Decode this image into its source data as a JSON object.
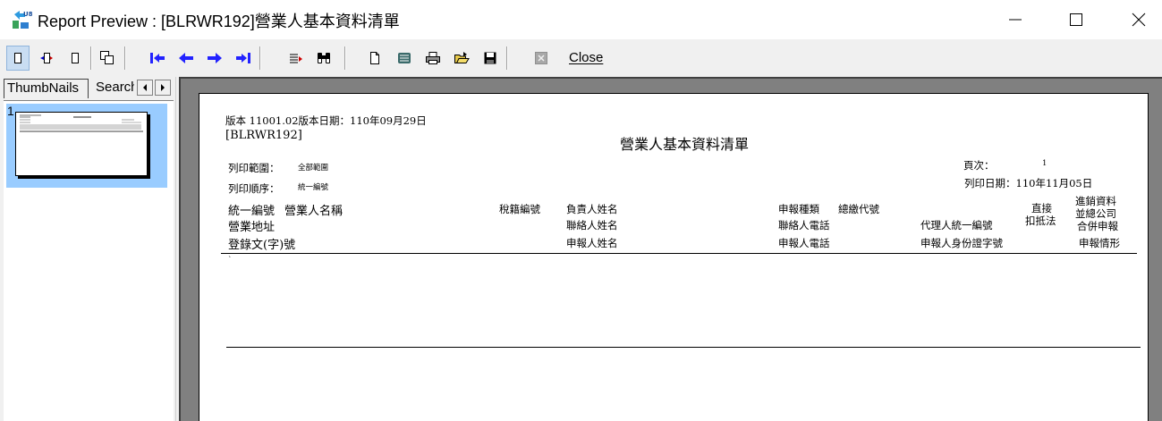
{
  "window": {
    "title": "Report Preview : [BLRWR192]營業人基本資料清單",
    "icon_label": "U8",
    "icon": "app-u8-icon",
    "controls": [
      "minimize-icon",
      "maximize-icon",
      "close-icon"
    ]
  },
  "toolbar": {
    "close_label": "Close",
    "icons": [
      "single-page-icon",
      "two-page-icon",
      "page-width-icon",
      "multi-page-icon",
      "first-page-icon",
      "prev-page-icon",
      "next-page-icon",
      "last-page-icon",
      "goto-page-icon",
      "find-icon",
      "new-page-icon",
      "export-icon",
      "print-icon",
      "open-icon",
      "save-icon",
      "stop-icon"
    ]
  },
  "left_panel": {
    "tabs": [
      "ThumbNails",
      "Search"
    ],
    "thumbnails": [
      {
        "page": "1"
      }
    ]
  },
  "report": {
    "version_line": "版本 11001.02版本日期：110年09月29日",
    "report_code": "[BLRWR192]",
    "title": "營業人基本資料清單",
    "print_range_label": "列印範圍：",
    "print_range_value": "全部範圍",
    "print_order_label": "列印順序：",
    "print_order_value": "統一編號",
    "page_label": "頁次：",
    "page_value": "1",
    "print_date": "列印日期：110年11月05日",
    "columns": {
      "row1": {
        "tax_id": "統一編號",
        "name": "營業人名稱",
        "tax_reg_no": "稅籍編號",
        "owner_name": "負責人姓名",
        "declare_type": "申報種類",
        "headquarter_code": "總繳代號",
        "direct_deduction_1": "直接",
        "import_export_1": "進銷資料",
        "import_export_2": "並總公司"
      },
      "row2": {
        "address": "營業地址",
        "contact_name": "聯絡人姓名",
        "contact_phone": "聯絡人電話",
        "agent_tax_id": "代理人統一編號",
        "direct_deduction_2": "扣抵法",
        "combined_declare": "合併申報"
      },
      "row3": {
        "registration_no": "登錄文(字)號",
        "declarant_name": "申報人姓名",
        "declarant_phone": "申報人電話",
        "declarant_id": "申報人身份證字號",
        "declare_status": "申報情形"
      }
    },
    "stray_mark": "`"
  }
}
